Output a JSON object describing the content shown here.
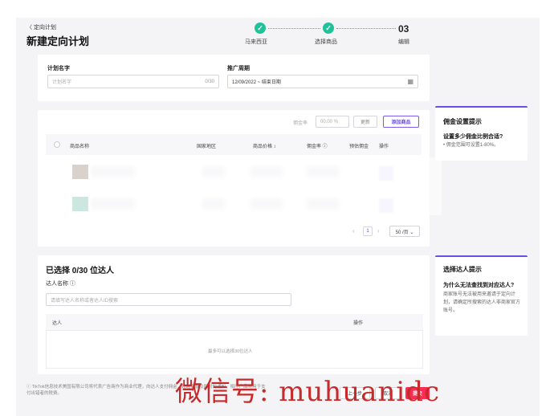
{
  "header": {
    "back_label": "〈 定向计划",
    "title": "新建定向计划"
  },
  "steps": [
    {
      "marker": "✓",
      "label": "马来西亚"
    },
    {
      "marker": "✓",
      "label": "选择商品"
    },
    {
      "marker": "03",
      "label": "编辑"
    }
  ],
  "plan_form": {
    "name_label": "计划名字",
    "name_placeholder": "计划名字",
    "name_counter": "0/30",
    "period_label": "推广周期",
    "period_value": "12/09/2022 ~ 结束日期",
    "calendar_icon": "calendar-icon"
  },
  "products": {
    "commission_label": "佣金率",
    "commission_placeholder": "00.00 %",
    "update_label": "更新",
    "add_label": "添加商品",
    "columns": [
      "商品名称",
      "国家地区",
      "商品价格 ↕",
      "佣金率 ⓘ",
      "预估佣金",
      "操作"
    ],
    "thumb_colors": [
      "#a89a8e",
      "#8fcab8"
    ],
    "pagination": {
      "prev": "‹",
      "page": "1",
      "next": "›",
      "page_size": "50 /页 ⌄"
    }
  },
  "commission_tip": {
    "title": "佣金设置提示",
    "question": "设置多少佣金比例合适?",
    "answer": "• 佣金范围可设置1-80%。"
  },
  "creators": {
    "title": "已选择 0/30 位达人",
    "name_label": "达人名称 ⓘ",
    "search_placeholder": "请填写达人名称或者达人ID搜索",
    "col_creator": "达人",
    "col_action": "操作",
    "empty_text": "最多可以选择30位达人"
  },
  "creator_tip": {
    "title": "选择达人提示",
    "question": "为什么无法查找到对应达人?",
    "answer": "商家账号无法被用来邀请于定向计划，请确定所搜索的达人非商家官方账号。"
  },
  "footer": {
    "disclaimer_line1": "ⓘ TikTok信息技术美国有限公司将代表广告商作为商业代理，向达人支付佣金，超越条款及所附的通知，相应产品将用于支",
    "disclaimer_line2": "付出错者的税费。",
    "prev_label": "上一步",
    "cancel_label": "取消",
    "submit_label": "提交"
  },
  "watermark": "微信号: muhuanidc",
  "colors": {
    "accent": "#fe2c55",
    "purple": "#6a4ce6",
    "success": "#21c19a"
  }
}
